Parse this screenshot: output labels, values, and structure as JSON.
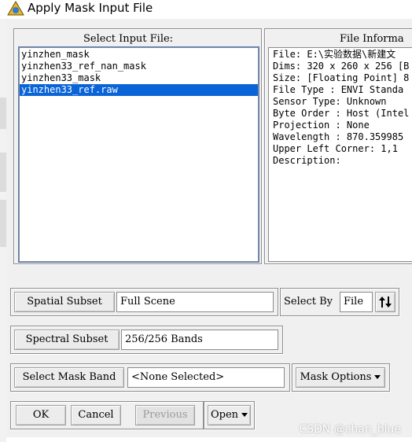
{
  "window": {
    "title": "Apply Mask Input File"
  },
  "select_input": {
    "heading": "Select Input File:",
    "files": [
      {
        "label": "yinzhen_mask",
        "selected": false
      },
      {
        "label": "yinzhen33_ref_nan_mask",
        "selected": false
      },
      {
        "label": "yinzhen33_mask",
        "selected": false
      },
      {
        "label": "yinzhen33_ref.raw",
        "selected": true
      }
    ]
  },
  "file_info": {
    "heading": "File Informa",
    "lines": [
      "File: E:\\实验数据\\新建文",
      "Dims: 320 x 260 x 256 [B",
      "Size: [Floating Point] 8",
      "File Type : ENVI Standa",
      "Sensor Type: Unknown",
      "Byte Order : Host (Intel",
      "Projection : None",
      "Wavelength : 870.359985",
      "Upper Left Corner: 1,1",
      "Description:"
    ]
  },
  "spatial_subset": {
    "button": "Spatial Subset",
    "value": "Full Scene"
  },
  "select_by": {
    "label": "Select By",
    "value": "File",
    "toggle_icon": "sort-up-down-icon"
  },
  "spectral_subset": {
    "button": "Spectral Subset",
    "value": "256/256 Bands"
  },
  "mask_band": {
    "button": "Select Mask Band",
    "value": "<None Selected>",
    "options_button": "Mask Options"
  },
  "actions": {
    "ok": "OK",
    "cancel": "Cancel",
    "previous": "Previous",
    "open": "Open"
  },
  "watermark": "CSDN @chan_blue"
}
